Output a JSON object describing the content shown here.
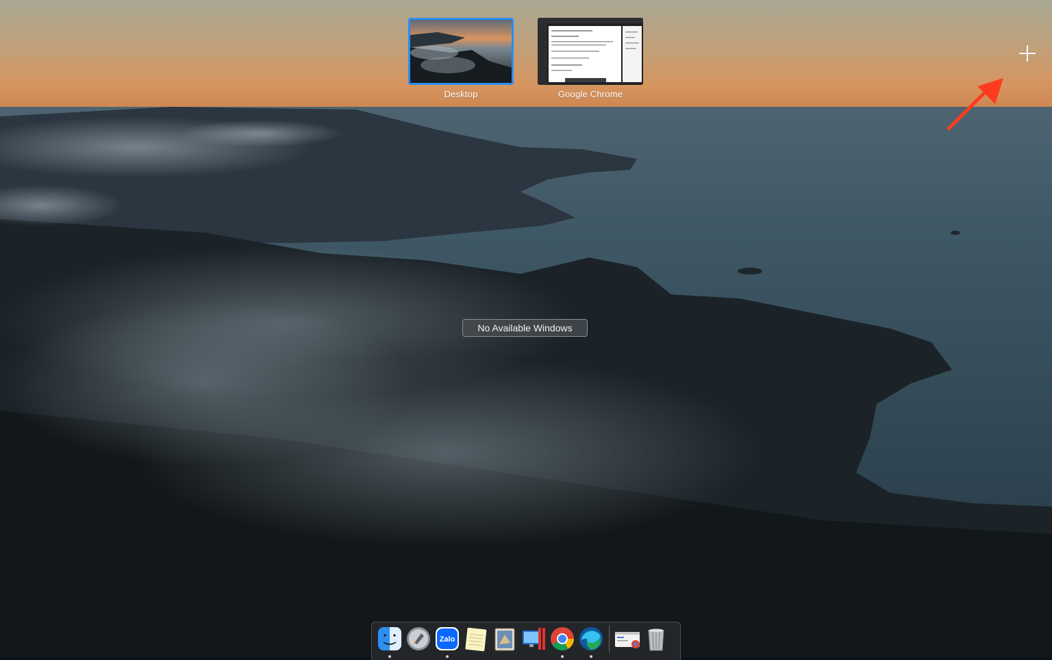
{
  "spaces": {
    "items": [
      {
        "label": "Desktop",
        "selected": true
      },
      {
        "label": "Google Chrome",
        "selected": false
      }
    ],
    "add_icon": "plus-icon"
  },
  "message": "No Available Windows",
  "annotation": {
    "icon": "red-arrow-icon",
    "color": "#ff3b1f"
  },
  "dock": {
    "apps": [
      {
        "name": "Finder",
        "icon": "finder-icon",
        "running": true
      },
      {
        "name": "Launchpad",
        "icon": "launchpad-icon",
        "running": false
      },
      {
        "name": "Zalo",
        "icon": "zalo-icon",
        "running": true
      },
      {
        "name": "Notes",
        "icon": "notes-icon",
        "running": false
      },
      {
        "name": "Mail",
        "icon": "mail-icon",
        "running": false
      },
      {
        "name": "Parallels Desktop",
        "icon": "parallels-icon",
        "running": false
      },
      {
        "name": "Google Chrome",
        "icon": "chrome-icon",
        "running": true
      },
      {
        "name": "Microsoft Edge",
        "icon": "edge-icon",
        "running": true
      }
    ],
    "others": [
      {
        "name": "Chrome window",
        "icon": "chrome-window-icon"
      },
      {
        "name": "Trash",
        "icon": "trash-icon"
      }
    ],
    "zalo_text": "Zalo"
  },
  "colors": {
    "selection": "#2d8cf0",
    "arrow": "#ff3b1f"
  }
}
